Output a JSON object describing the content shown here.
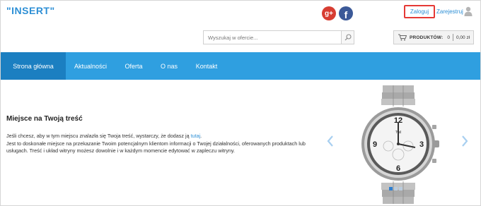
{
  "header": {
    "logo": "\"INSERT\"",
    "social": {
      "gplus_glyph": "g+",
      "facebook_glyph": "f"
    },
    "login_label": "Zaloguj",
    "register_label": "Zarejestruj",
    "user_icon": "user-icon"
  },
  "search": {
    "placeholder": "Wyszukaj w ofercie...",
    "icon": "search-icon"
  },
  "cart": {
    "icon": "cart-icon",
    "label": "PRODUKTÓW:",
    "count": "0",
    "total": "0,00 zł"
  },
  "nav": {
    "items": [
      {
        "label": "Strona główna"
      },
      {
        "label": "Aktualności"
      },
      {
        "label": "Oferta"
      },
      {
        "label": "O nas"
      },
      {
        "label": "Kontakt"
      }
    ],
    "active_index": 0,
    "color": "#2f9fe0",
    "active_color": "#1b7fc1"
  },
  "main": {
    "title": "Miejsce na Twoją treść",
    "line1_before": "Jeśli chcesz, aby w tym miejscu znalazła się Twoja treść, wystarczy, że dodasz ją ",
    "line1_link": "tutaj",
    "line1_after": ".",
    "line2": "Jest to doskonałe miejsce na przekazanie Twoim potencjalnym klientom informacji o Twojej działalności, oferowanych produktach lub usługach. Treść i układ witryny możesz dowolnie i w każdym momencie edytować w zapleczu witryny."
  },
  "slider": {
    "watch_brand": "Twil",
    "prev_icon": "chevron-left-icon",
    "next_icon": "chevron-right-icon",
    "slide_count": 3,
    "active_slide": 0
  },
  "colors": {
    "accent": "#2d8fd5",
    "highlight_border": "#e53935"
  }
}
